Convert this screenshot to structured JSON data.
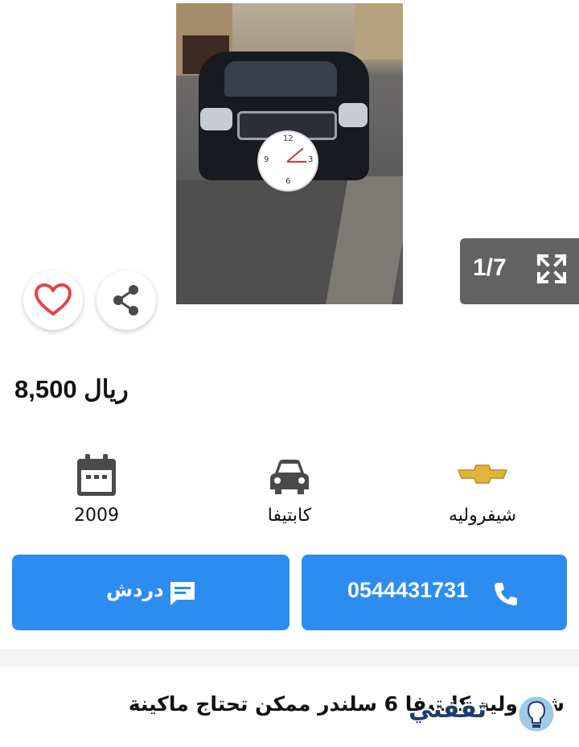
{
  "gallery": {
    "counter": "1/7",
    "clock_numbers": [
      "12",
      "3",
      "6",
      "9"
    ]
  },
  "listing": {
    "price": "8,500 ريال",
    "specs": {
      "year": "2009",
      "model": "كابتيفا",
      "make": "شيفروليه"
    },
    "call_button_label": "0544431731",
    "chat_button_label": "دردش",
    "description_title": "شفروليه كابتيفا 6 سلندر ممكن تحتاج ماكينة"
  },
  "watermark": {
    "text": "ثقفني"
  },
  "icons": {
    "prev": "chevron-left-icon",
    "next": "chevron-right-icon",
    "expand": "expand-icon",
    "share": "share-icon",
    "favorite": "heart-icon",
    "calendar": "calendar-icon",
    "car": "car-icon",
    "brand": "chevrolet-logo-icon",
    "phone": "phone-icon",
    "chat": "chat-icon"
  },
  "colors": {
    "primary": "#2d8cf0",
    "heart": "#e2434b",
    "counter_bg": "#626262",
    "icon_gray": "#4a4a4a",
    "brand_gold": "#e0b53a"
  }
}
